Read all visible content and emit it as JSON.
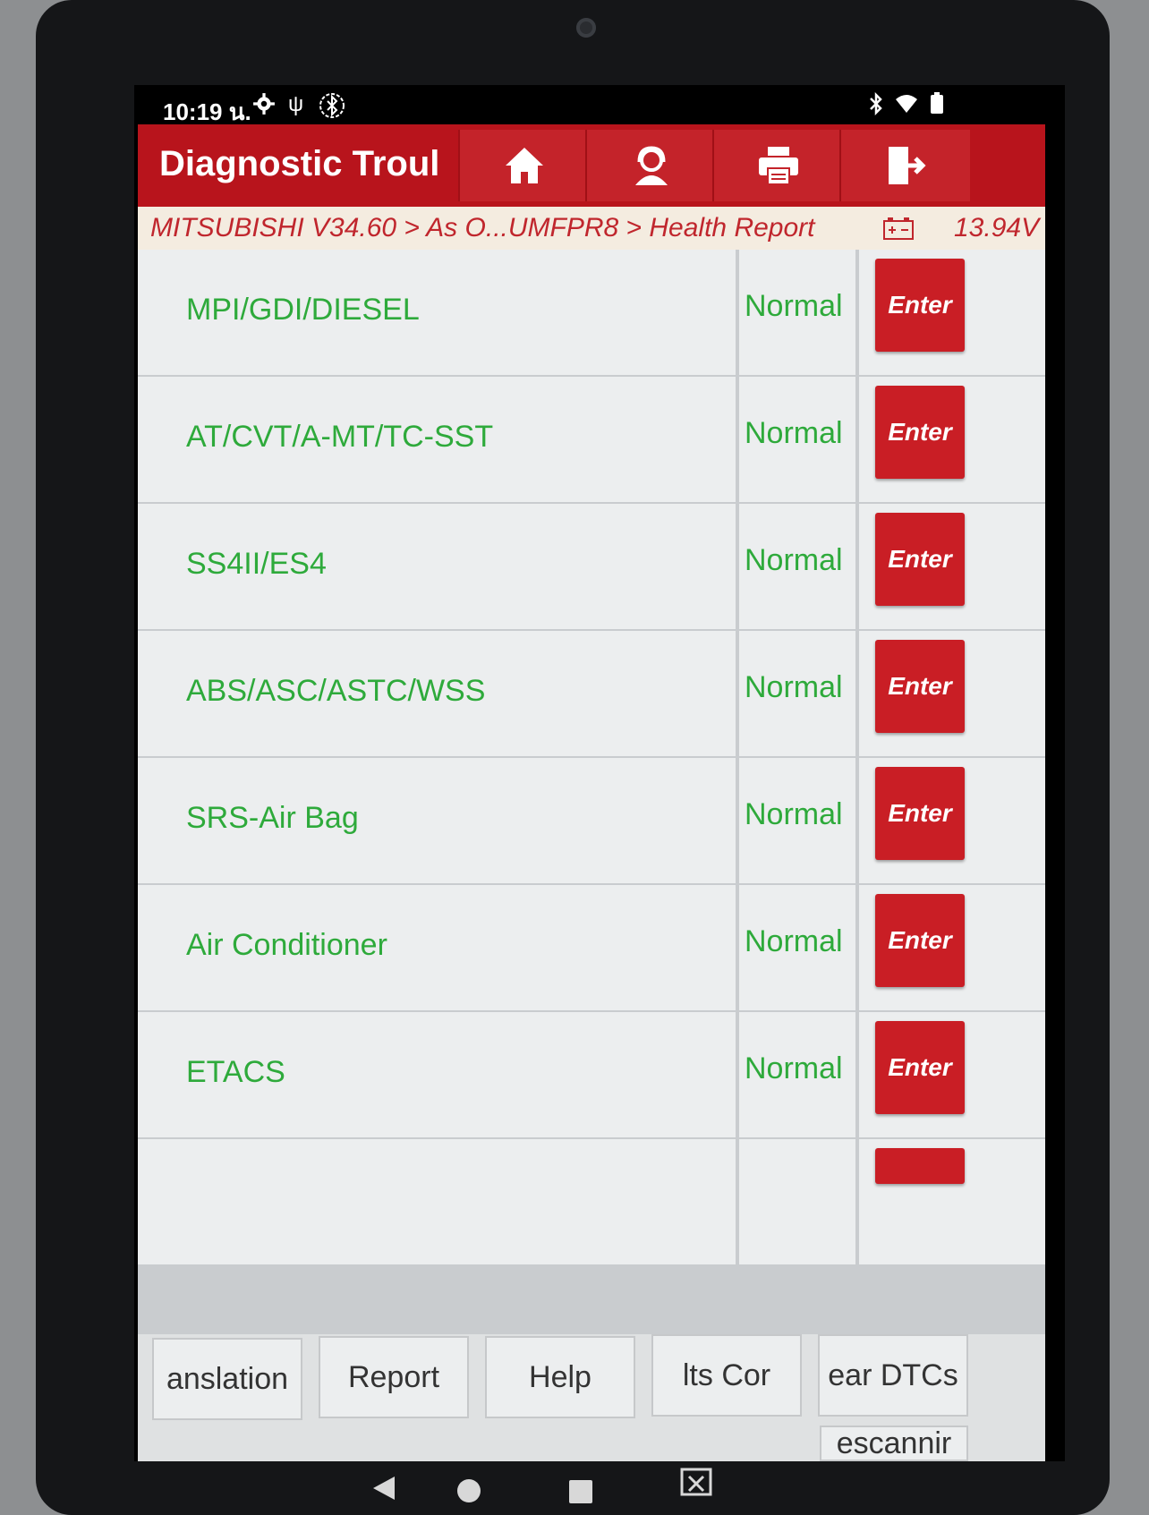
{
  "status_bar": {
    "time": "10:19 น.",
    "icons": [
      "gear-icon",
      "stethoscope-icon",
      "vci-bluetooth-icon",
      "bluetooth-icon",
      "wifi-icon",
      "battery-icon"
    ]
  },
  "title_bar": {
    "title": "Diagnostic Troul",
    "buttons": [
      "home-icon",
      "support-icon",
      "print-icon",
      "exit-icon"
    ]
  },
  "breadcrumb": {
    "path": "MITSUBISHI V34.60 > As O...UMFPR8 > Health Report",
    "voltage": "13.94V"
  },
  "systems": [
    {
      "name": "MPI/GDI/DIESEL",
      "status": "Normal",
      "action": "Enter"
    },
    {
      "name": "AT/CVT/A-MT/TC-SST",
      "status": "Normal",
      "action": "Enter"
    },
    {
      "name": "SS4II/ES4",
      "status": "Normal",
      "action": "Enter"
    },
    {
      "name": "ABS/ASC/ASTC/WSS",
      "status": "Normal",
      "action": "Enter"
    },
    {
      "name": "SRS-Air Bag",
      "status": "Normal",
      "action": "Enter"
    },
    {
      "name": "Air Conditioner",
      "status": "Normal",
      "action": "Enter"
    },
    {
      "name": "ETACS",
      "status": "Normal",
      "action": "Enter"
    }
  ],
  "bottom_bar": {
    "translation": "anslation",
    "report": "Report",
    "help": "Help",
    "results": "lts     Cor",
    "clear_dtcs": "ear DTCs",
    "rescanning": "escannir"
  },
  "colors": {
    "brand_red": "#b8141c",
    "status_green": "#2eaa3b",
    "button_red": "#c91e25"
  }
}
